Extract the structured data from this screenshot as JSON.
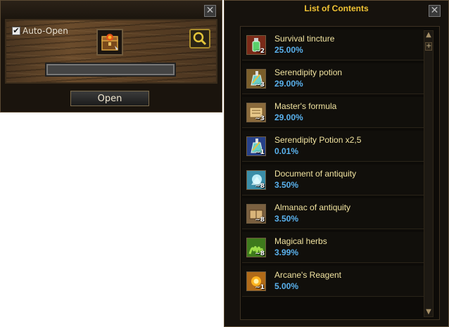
{
  "opener": {
    "auto_open_label": "Auto-Open",
    "auto_open_checked": true,
    "open_label": "Open",
    "progress": 0.0,
    "close_glyph": "✕",
    "check_glyph": "✔"
  },
  "contents": {
    "title": "List of Contents",
    "close_glyph": "✕",
    "scroll_up": "▲",
    "scroll_down": "▼",
    "scroll_plus": "+",
    "items": [
      {
        "name": "Survival tincture",
        "chance": "25.00%",
        "qty": "~2",
        "icon": "bottle-icon",
        "color": "#7a2a18"
      },
      {
        "name": "Serendipity potion",
        "chance": "29.00%",
        "qty": "~3",
        "icon": "potion-icon",
        "color": "#7a5e2a"
      },
      {
        "name": "Master's formula",
        "chance": "29.00%",
        "qty": "~3",
        "icon": "scroll-icon",
        "color": "#8a6a3c"
      },
      {
        "name": "Serendipity Potion x2,5",
        "chance": "0.01%",
        "qty": "~1",
        "icon": "potion-icon",
        "color": "#26418a"
      },
      {
        "name": "Document of antiquity",
        "chance": "3.50%",
        "qty": "~8",
        "icon": "document-icon",
        "color": "#3a8ea8"
      },
      {
        "name": "Almanac of antiquity",
        "chance": "3.50%",
        "qty": "~8",
        "icon": "almanac-icon",
        "color": "#7a6040"
      },
      {
        "name": "Magical herbs",
        "chance": "3.99%",
        "qty": "~8",
        "icon": "herb-icon",
        "color": "#3e7a1c"
      },
      {
        "name": "Arcane's Reagent",
        "chance": "5.00%",
        "qty": "~1",
        "icon": "reagent-icon",
        "color": "#b06a18"
      }
    ]
  }
}
